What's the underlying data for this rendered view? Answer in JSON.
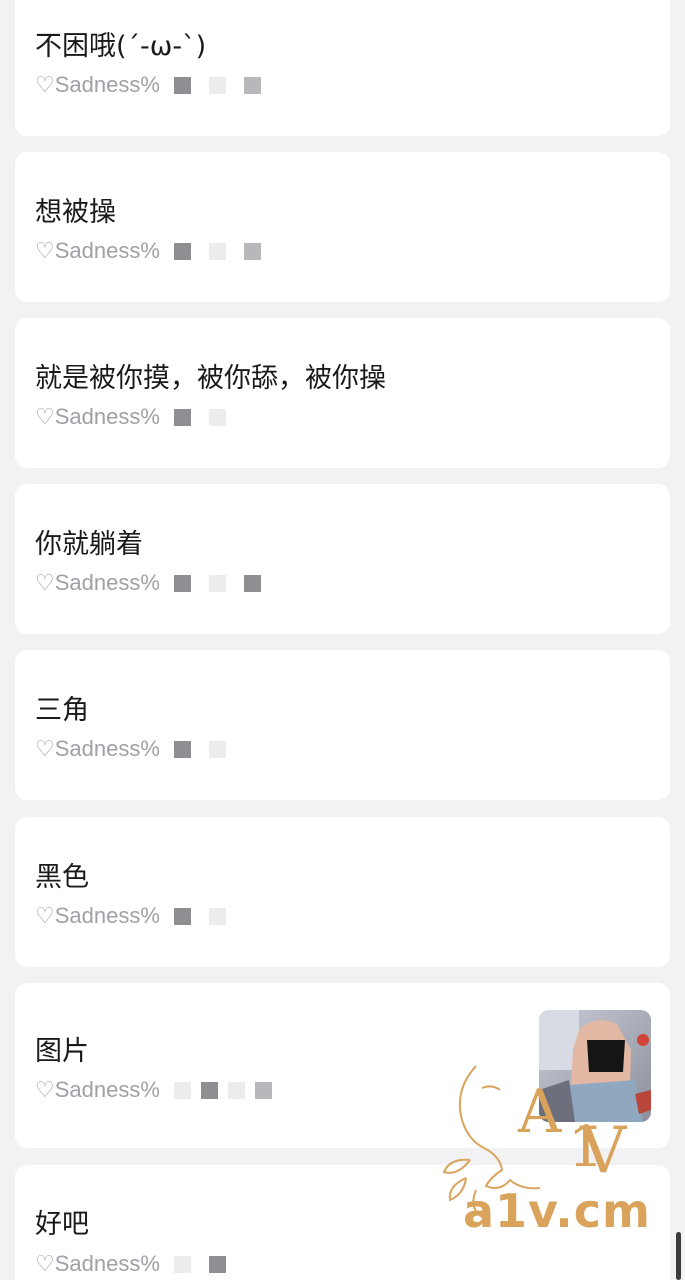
{
  "messages": [
    {
      "title": "不困哦(´-ω-`)",
      "author": "♡Sadness%"
    },
    {
      "title": "想被操",
      "author": "♡Sadness%"
    },
    {
      "title": "就是被你摸，被你舔，被你操",
      "author": "♡Sadness%"
    },
    {
      "title": "你就躺着",
      "author": "♡Sadness%"
    },
    {
      "title": "三角",
      "author": "♡Sadness%"
    },
    {
      "title": "黑色",
      "author": "♡Sadness%"
    },
    {
      "title": "图片",
      "author": "♡Sadness%",
      "thumbnail": "photo-thumbnail"
    },
    {
      "title": "好吧",
      "author": "♡Sadness%"
    }
  ],
  "watermark": {
    "text": "a1v.cm",
    "monogram": "A1V",
    "color": "#d9a35b"
  }
}
